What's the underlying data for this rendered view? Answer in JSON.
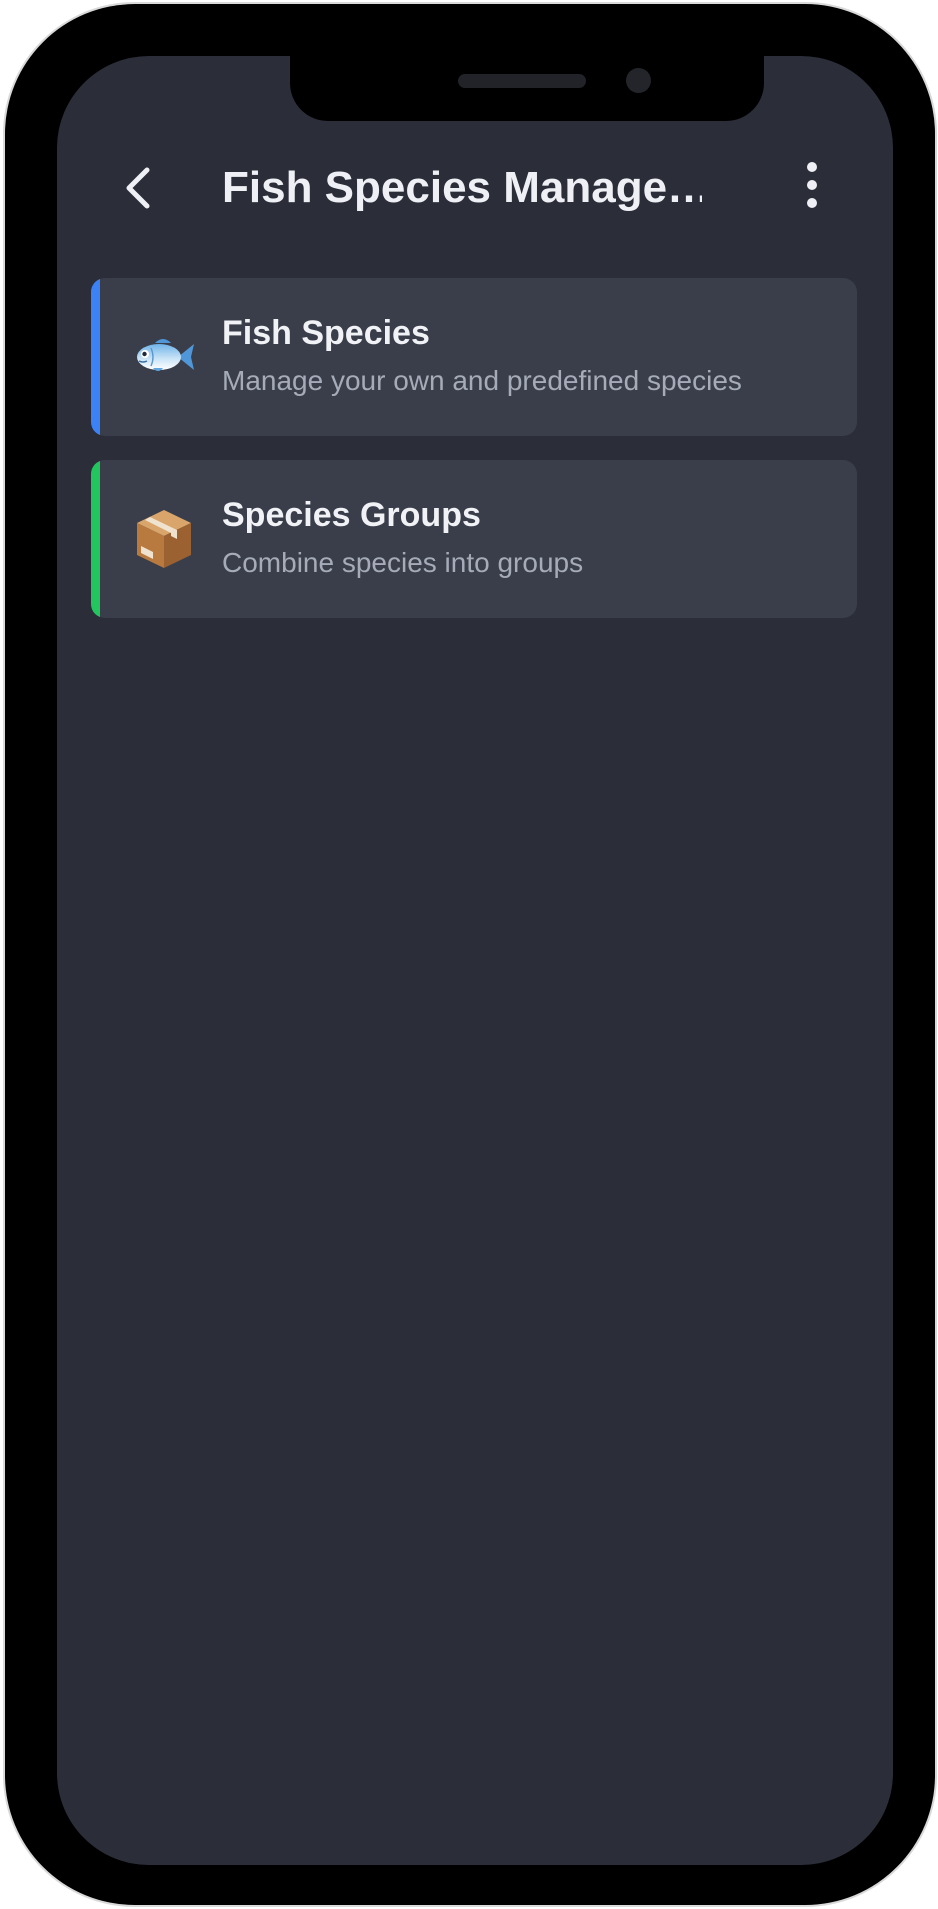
{
  "app_bar": {
    "title": "Fish Species Manage…",
    "back_icon": "chevron-left-icon",
    "menu_icon": "more-vertical-icon"
  },
  "menu_items": [
    {
      "icon": "fish-icon",
      "title": "Fish Species",
      "subtitle": "Manage your own and predefined species",
      "accent": "#3b82f6"
    },
    {
      "icon": "package-icon",
      "title": "Species Groups",
      "subtitle": "Combine species into groups",
      "accent": "#22c55e"
    }
  ],
  "colors": {
    "background": "#2b2e39",
    "card": "#3a3e4a",
    "title_text": "#f0f2f6",
    "subtitle_text": "#a5abb8"
  }
}
